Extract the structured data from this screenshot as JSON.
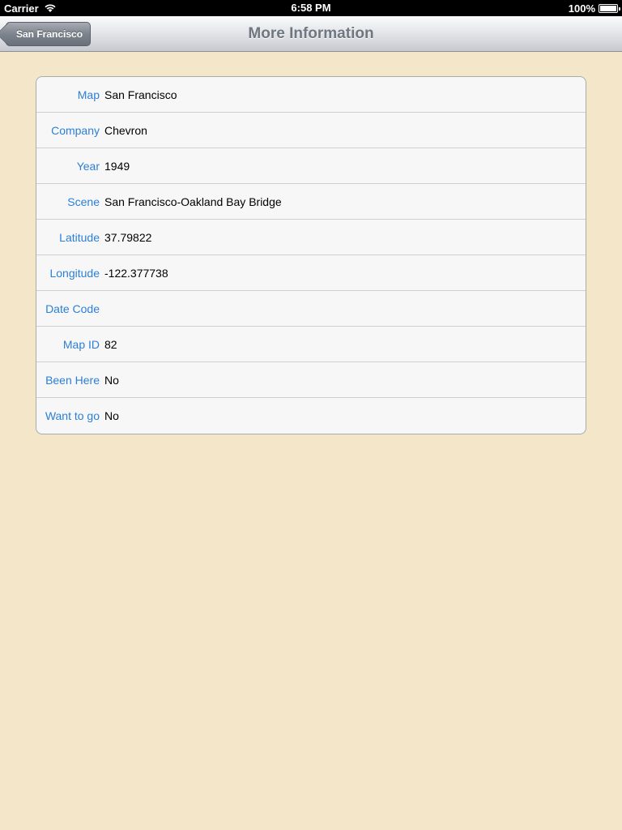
{
  "status_bar": {
    "carrier": "Carrier",
    "time": "6:58 PM",
    "battery": "100%",
    "icons": [
      "wifi-icon",
      "battery-icon"
    ]
  },
  "nav_bar": {
    "back_label": "San Francisco",
    "title": "More Information"
  },
  "rows": [
    {
      "label": "Map",
      "value": "San Francisco"
    },
    {
      "label": "Company",
      "value": "Chevron"
    },
    {
      "label": "Year",
      "value": "1949"
    },
    {
      "label": "Scene",
      "value": "San Francisco-Oakland Bay Bridge"
    },
    {
      "label": "Latitude",
      "value": "37.79822"
    },
    {
      "label": "Longitude",
      "value": "-122.377738"
    },
    {
      "label": "Date Code",
      "value": ""
    },
    {
      "label": "Map ID",
      "value": "82"
    },
    {
      "label": "Been Here",
      "value": "No"
    },
    {
      "label": "Want to go",
      "value": "No"
    }
  ],
  "colors": {
    "background": "#f3e6c9",
    "label": "#2b7fd6",
    "title": "#6f7780"
  }
}
